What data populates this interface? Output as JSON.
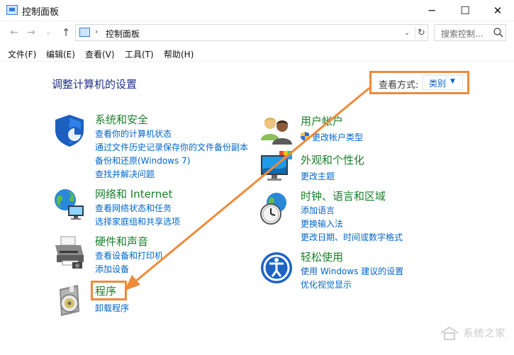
{
  "window": {
    "title": "控制面板",
    "minimize_glyph": "─",
    "maximize_glyph": "☐",
    "close_glyph": "✕"
  },
  "nav": {
    "back_glyph": "←",
    "forward_glyph": "→",
    "recent_glyph": "⌄",
    "up_glyph": "↑",
    "breadcrumb_sep": "›",
    "breadcrumb": "控制面板",
    "dropdown_glyph": "⌄",
    "refresh_glyph": "↻",
    "search_placeholder": "搜索控制...",
    "search_icon": "search-icon"
  },
  "menu": [
    "文件(F)",
    "编辑(E)",
    "查看(V)",
    "工具(T)",
    "帮助(H)"
  ],
  "heading": "调整计算机的设置",
  "view_by": {
    "label": "查看方式:",
    "value": "类别",
    "caret": "▼"
  },
  "categories": {
    "system_security": {
      "icon": "shield-icon",
      "title": "系统和安全",
      "links": [
        "查看你的计算机状态",
        "通过文件历史记录保存你的文件备份副本",
        "备份和还原(Windows 7)",
        "查找并解决问题"
      ]
    },
    "network": {
      "icon": "network-globe-icon",
      "title": "网络和 Internet",
      "links": [
        "查看网络状态和任务",
        "选择家庭组和共享选项"
      ]
    },
    "hardware": {
      "icon": "printer-icon",
      "title": "硬件和声音",
      "links": [
        "查看设备和打印机",
        "添加设备"
      ]
    },
    "programs": {
      "icon": "programs-disc-icon",
      "title": "程序",
      "links": [
        "卸载程序"
      ]
    },
    "user_accounts": {
      "icon": "users-icon",
      "title": "用户帐户",
      "links": [
        "更改帐户类型"
      ]
    },
    "appearance": {
      "icon": "monitor-palette-icon",
      "title": "外观和个性化",
      "links": [
        "更改主题"
      ]
    },
    "clock_region": {
      "icon": "clock-globe-icon",
      "title": "时钟、语言和区域",
      "links": [
        "添加语言",
        "更换输入法",
        "更改日期、时间或数字格式"
      ]
    },
    "ease_of_access": {
      "icon": "ease-of-access-icon",
      "title": "轻松使用",
      "links": [
        "使用 Windows 建议的设置",
        "优化视觉显示"
      ]
    }
  },
  "annotation": {
    "color": "#ef8a3a"
  },
  "watermark": {
    "text": "系统之家",
    "icon": "house-logo-icon"
  }
}
